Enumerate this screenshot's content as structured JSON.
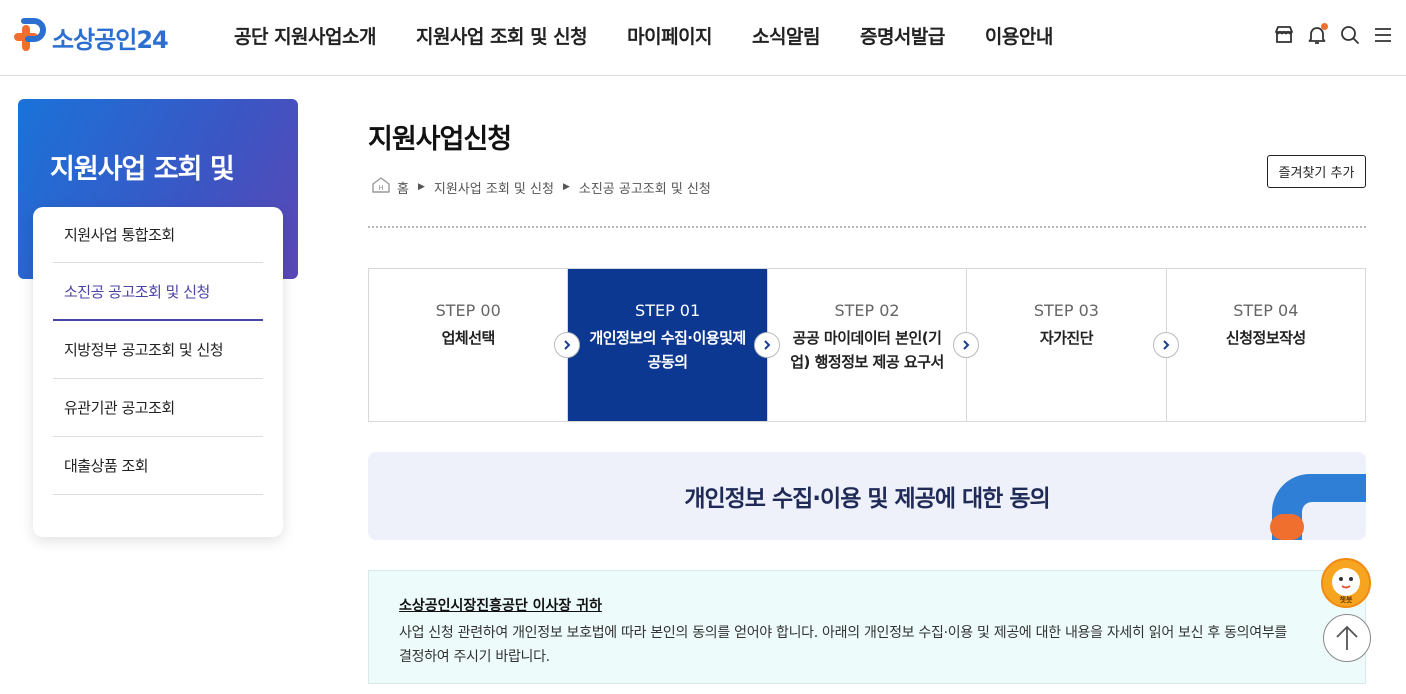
{
  "header": {
    "logo_text": "소상공인24",
    "nav": [
      "공단 지원사업소개",
      "지원사업 조회 및 신청",
      "마이페이지",
      "소식알림",
      "증명서발급",
      "이용안내"
    ],
    "icons": [
      "store-icon",
      "bell-icon",
      "search-icon",
      "menu-icon"
    ]
  },
  "sidebar": {
    "title": "지원사업 조회 및",
    "items": [
      {
        "label": "지원사업 통합조회"
      },
      {
        "label": "소진공 공고조회 및 신청",
        "active": true
      },
      {
        "label": "지방정부 공고조회 및 신청"
      },
      {
        "label": "유관기관 공고조회"
      },
      {
        "label": "대출상품 조회"
      }
    ]
  },
  "main": {
    "title": "지원사업신청",
    "favorite_label": "즐겨찾기 추가",
    "breadcrumb": [
      "홈",
      "지원사업 조회 및 신청",
      "소진공 공고조회 및 신청"
    ],
    "steps": [
      {
        "num": "STEP 00",
        "label": "업체선택"
      },
      {
        "num": "STEP 01",
        "label": "개인정보의 수집·이용및제공동의",
        "active": true
      },
      {
        "num": "STEP 02",
        "label": "공공 마이데이터 본인(기업) 행정정보 제공 요구서"
      },
      {
        "num": "STEP 03",
        "label": "자가진단"
      },
      {
        "num": "STEP 04",
        "label": "신청정보작성"
      }
    ],
    "section_title": "개인정보 수집·이용 및 제공에 대한 동의",
    "info": {
      "heading": "소상공인시장진흥공단 이사장 귀하",
      "body": "사업 신청 관련하여 개인정보 보호법에 따라 본인의 동의를 얻어야 합니다. 아래의 개인정보 수집·이용 및 제공에 대한 내용을 자세히 읽어 보신 후 동의여부를 결정하여 주시기 바랍니다."
    }
  },
  "floating": {
    "chatbot_label": "챗봇"
  },
  "colors": {
    "brand_blue": "#2c6fd1",
    "brand_orange": "#f06f2f",
    "step_active": "#0d3891",
    "menu_active": "#4b45a6"
  }
}
